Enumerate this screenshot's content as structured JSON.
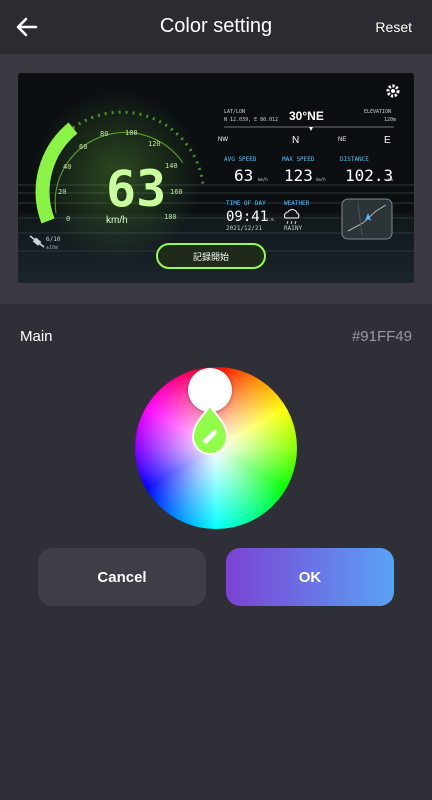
{
  "header": {
    "title": "Color setting",
    "reset_label": "Reset"
  },
  "icons": {
    "back": "arrow-left-icon",
    "settings": "gear-icon",
    "satellite": "satellite-icon",
    "weather": "cloud-rain-icon",
    "picker": "pencil-drop-icon"
  },
  "preview": {
    "speed": "63",
    "speed_unit": "km/h",
    "gauge_ticks": [
      "0",
      "20",
      "40",
      "60",
      "80",
      "100",
      "120",
      "140",
      "160",
      "180"
    ],
    "latlon_label": "LAT/LON",
    "latlon_value": "N 12.039, E 80.012",
    "heading": "30°NE",
    "elevation_label": "ELEVATION",
    "elevation_value": "120m",
    "compass": [
      "NW",
      "N",
      "NE",
      "E"
    ],
    "avg_speed_label": "AVG SPEED",
    "avg_speed_value": "63",
    "max_speed_label": "MAX SPEED",
    "max_speed_value": "123",
    "distance_label": "DISTANCE",
    "distance_value": "102.3",
    "unit_kmh": "km/h",
    "unit_km": "km",
    "time_label": "TIME OF DAY",
    "time_value": "09:41",
    "time_suffix": "a.m.",
    "date_value": "2021/12/21",
    "weather_label": "WEATHER",
    "weather_value": "RAINY",
    "gps_count": "6/10",
    "gps_accuracy": "±10m",
    "record_label": "記録開始"
  },
  "color": {
    "label": "Main",
    "hex": "#91FF49",
    "accent": "#91FF49"
  },
  "buttons": {
    "cancel": "Cancel",
    "ok": "OK"
  }
}
